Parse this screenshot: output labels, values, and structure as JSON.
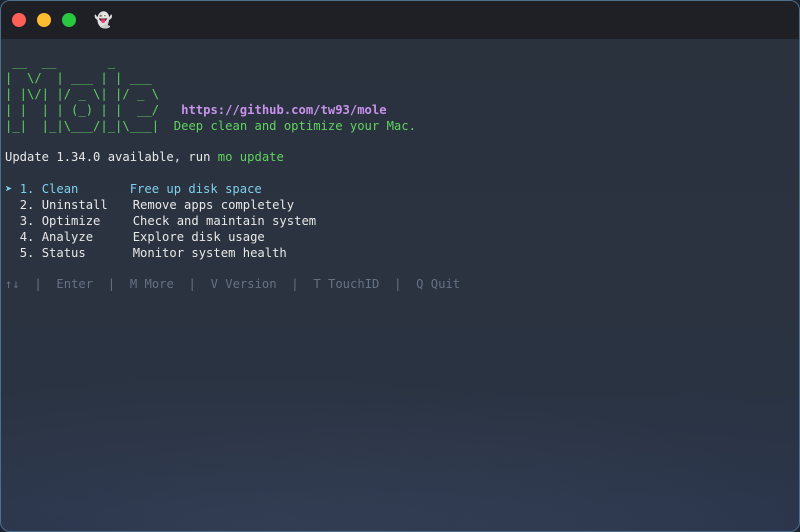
{
  "window": {
    "tab_icon": "ghost-icon",
    "tab_glyph": "👻"
  },
  "logo": {
    "lines": [
      " __  __       _",
      "|  \\/  | ___ | | ___",
      "| |\\/| |/ _ \\| |/ _ \\",
      "| |  | | (_) | |  __/",
      "|_|  |_|\\___/|_|\\___|"
    ],
    "url": "https://github.com/tw93/mole",
    "tagline": "Deep clean and optimize your Mac."
  },
  "update": {
    "text": "Update 1.34.0 available, run ",
    "command": "mo update"
  },
  "menu": {
    "pointer": "➤",
    "items": [
      {
        "label": "1. Clean",
        "description": "Free up disk space"
      },
      {
        "label": "2. Uninstall",
        "description": "Remove apps completely"
      },
      {
        "label": "3. Optimize",
        "description": "Check and maintain system"
      },
      {
        "label": "4. Analyze",
        "description": "Explore disk usage"
      },
      {
        "label": "5. Status",
        "description": "Monitor system health"
      }
    ]
  },
  "footer": {
    "arrows": "↑↓",
    "enter": "Enter",
    "more": "M More",
    "version": "V Version",
    "touchid": "T TouchID",
    "quit": "Q Quit",
    "separator": "|"
  },
  "colors": {
    "logo_green": "#5fd35f",
    "url_purple": "#c792ea",
    "selected_cyan": "#7fd0ee",
    "footer_dim": "#667185"
  }
}
